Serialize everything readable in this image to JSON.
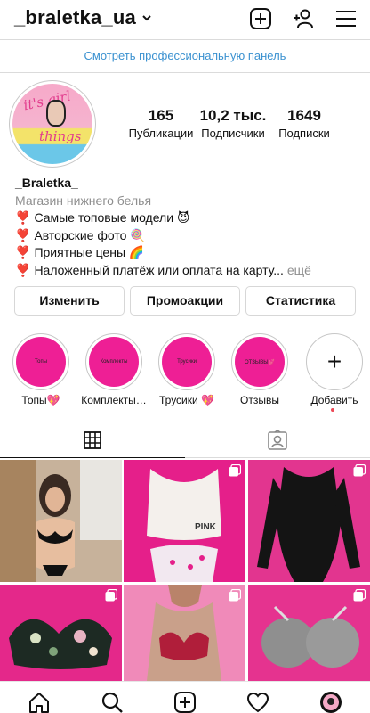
{
  "header": {
    "username": "_braletka_ua"
  },
  "pro_panel": {
    "label": "Смотреть профессиональную панель"
  },
  "stats": [
    {
      "value": "165",
      "label": "Публикации"
    },
    {
      "value": "10,2 тыс.",
      "label": "Подписчики"
    },
    {
      "value": "1649",
      "label": "Подписки"
    }
  ],
  "bio": {
    "name": "_Braletka_",
    "category": "Магазин нижнего белья",
    "lines": [
      "Самые топовые модели 😈",
      "Авторские фото 🍭",
      "Приятные цены 🌈",
      "Наложенный платёж или оплата на карту..."
    ],
    "more": "ещё",
    "bullet": "❣️"
  },
  "buttons": {
    "edit": "Изменить",
    "promo": "Промоакции",
    "stats": "Статистика"
  },
  "highlights": [
    {
      "label": "Топы💖",
      "cover_text": "Топы"
    },
    {
      "label": "Комплекты…",
      "cover_text": "Комплекты"
    },
    {
      "label": "Трусики 💖",
      "cover_text": "Трусики"
    },
    {
      "label": "Отзывы",
      "cover_text": "ОТЗЫВЫ💕"
    },
    {
      "label": "Добавить",
      "cover_text": "+"
    }
  ],
  "posts": [
    {
      "label": "Девушка в чёрном комплекте",
      "multiple": false
    },
    {
      "label": "Белый топ PINK",
      "multiple": true,
      "print": "PINK"
    },
    {
      "label": "Чёрное боди",
      "multiple": true
    },
    {
      "label": "Цветочный бралетт",
      "multiple": true
    },
    {
      "label": "Красный комплект на манекене",
      "multiple": true
    },
    {
      "label": "Серые бюстгальтеры",
      "multiple": true
    }
  ],
  "colors": {
    "accent_blue": "#3a91d0",
    "highlight_pink": "#ee1f95",
    "notification_red": "#ed4956"
  }
}
